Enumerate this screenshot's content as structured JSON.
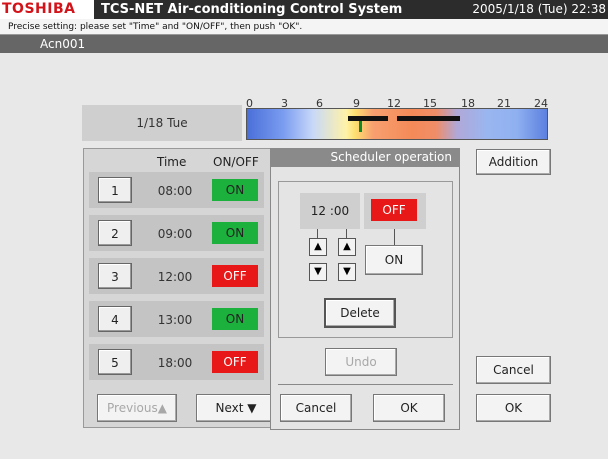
{
  "header": {
    "brand": "TOSHIBA",
    "app_title": "TCS-NET Air-conditioning Control System",
    "datetime": "2005/1/18 (Tue) 22:38"
  },
  "instruction": "Precise setting: please set \"Time\" and \"ON/OFF\", then push \"OK\".",
  "unit_name": "Acn001",
  "timeline": {
    "date_label": "1/18 Tue",
    "hour_ticks": [
      "0",
      "3",
      "6",
      "9",
      "12",
      "15",
      "18",
      "21",
      "24"
    ]
  },
  "schedule_list": {
    "col_time": "Time",
    "col_onoff": "ON/OFF",
    "rows": [
      {
        "num": "1",
        "time": "08:00",
        "state": "ON"
      },
      {
        "num": "2",
        "time": "09:00",
        "state": "ON"
      },
      {
        "num": "3",
        "time": "12:00",
        "state": "OFF"
      },
      {
        "num": "4",
        "time": "13:00",
        "state": "ON"
      },
      {
        "num": "5",
        "time": "18:00",
        "state": "OFF"
      }
    ],
    "previous_label": "Previous▲",
    "next_label": "Next ▼"
  },
  "scheduler": {
    "title": "Scheduler operation",
    "time_value": "12 :00",
    "state_value": "OFF",
    "on_label": "ON",
    "delete_label": "Delete",
    "undo_label": "Undo",
    "cancel_label": "Cancel",
    "ok_label": "OK"
  },
  "right_actions": {
    "addition_label": "Addition",
    "cancel_label": "Cancel",
    "ok_label": "OK"
  },
  "colors": {
    "on_green": "#1cb03c",
    "off_red": "#e81818",
    "brand_red": "#d2141a"
  },
  "icons": [
    "up-arrow-icon",
    "down-arrow-icon"
  ]
}
